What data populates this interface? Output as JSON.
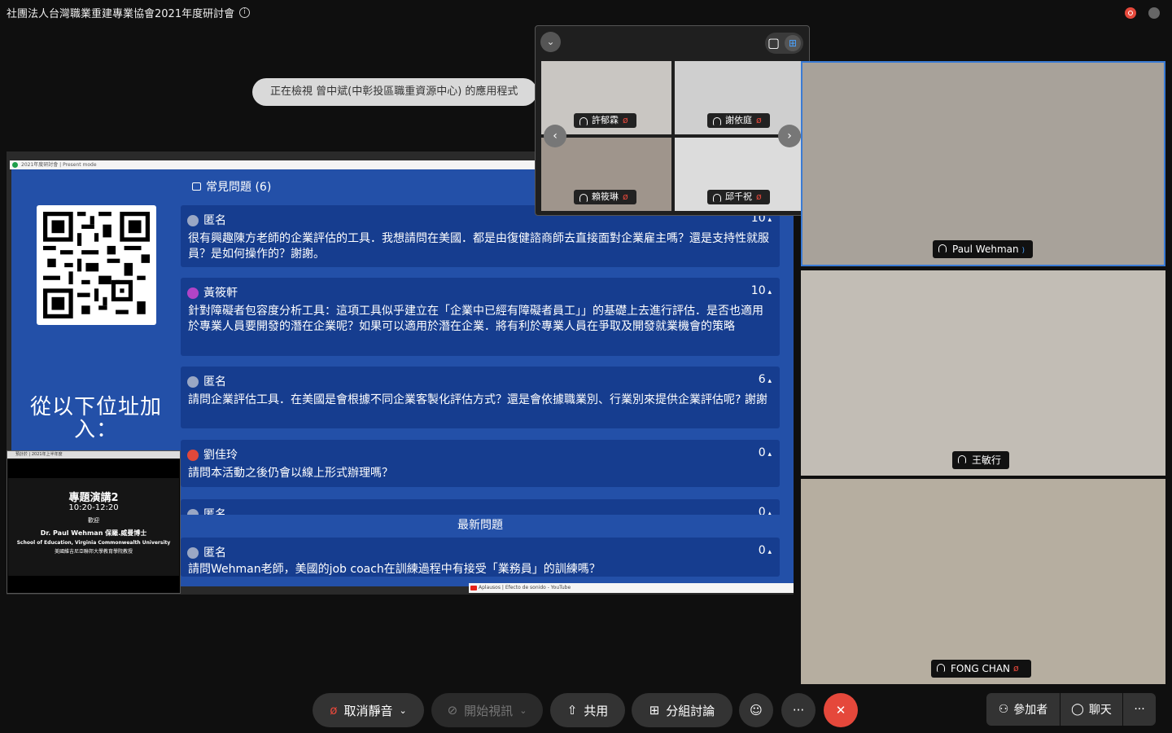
{
  "window": {
    "title": "社團法人台灣職業重建專業協會2021年度研討會"
  },
  "banner": {
    "text": "正在檢視 曾中斌(中彰投區職重資源中心) 的應用程式"
  },
  "share": {
    "browser_tab": "2021年度研討會 | Present mode",
    "join_text": "從以下位址加入：",
    "qa_title": "常見問題 (6)",
    "questions": [
      {
        "name": "匿名",
        "likes": "10",
        "text": "很有興趣陳方老師的企業評估的工具．我想請問在美國．都是由復健諮商師去直接面對企業雇主嗎？還是支持性就服員？是如何操作的？謝謝。"
      },
      {
        "name": "黃筱軒",
        "likes": "10",
        "text": "針對障礙者包容度分析工具：這項工具似乎建立在「企業中已經有障礙者員工」」的基礎上去進行評估．是否也適用於專業人員要開發的潛在企業呢？如果可以適用於潛在企業．將有利於專業人員在爭取及開發就業機會的策略"
      },
      {
        "name": "匿名",
        "likes": "6",
        "text": "請問企業評估工具．在美國是會根據不同企業客製化評估方式？還是會依據職業別、行業別來提供企業評估呢? 謝謝"
      },
      {
        "name": "劉佳玲",
        "likes": "0",
        "text": "請問本活動之後仍會以線上形式辦理嗎？"
      },
      {
        "name": "匿名",
        "likes": "0",
        "text": ""
      }
    ],
    "newest_label": "最新問題",
    "newest": {
      "name": "匿名",
      "likes": "0",
      "text": "請問Wehman老師，美國的job coach在訓練過程中有接受「業務員」的訓練嗎？"
    },
    "youtube_tab": "Aplausos | Efecto de sonido - YouTube"
  },
  "inset": {
    "bar": "預計於 | 2021年上半年度",
    "title": "專題演講2",
    "time": "10:20-12:20",
    "welcome": "歡迎",
    "speaker": "Dr. Paul Wehman 保羅.威曼博士",
    "affil_en": "School of Education, Virginia Commonwealth University",
    "affil_zh": "美國維吉尼亞聯邦大學教育學院教授"
  },
  "gallery": {
    "participants": [
      {
        "name": "許郁霖",
        "muted": true
      },
      {
        "name": "謝依庭",
        "muted": true
      },
      {
        "name": "賴筱琳",
        "muted": true
      },
      {
        "name": "邱千祝",
        "muted": true
      }
    ]
  },
  "videos": [
    {
      "name": "Paul Wehman",
      "muted": false
    },
    {
      "name": "王敏行",
      "muted": false
    },
    {
      "name": "FONG CHAN",
      "muted": true
    }
  ],
  "toolbar": {
    "mute": "取消靜音",
    "video": "開始視訊",
    "share": "共用",
    "breakout": "分組討論",
    "more": "···",
    "participants": "參加者",
    "chat": "聊天"
  }
}
